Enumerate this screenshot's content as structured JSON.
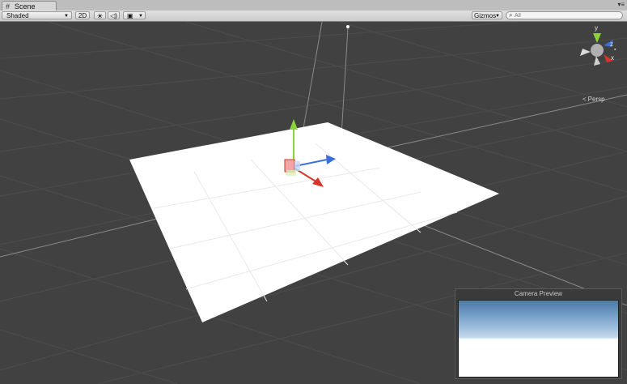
{
  "tab": {
    "icon": "scene-grid-icon",
    "label": "Scene",
    "menu_icon": "panel-menu-icon"
  },
  "toolbar": {
    "draw_mode": "Shaded",
    "btn_2d": "2D",
    "lighting_icon": "sun-icon",
    "audio_icon": "speaker-icon",
    "effects_icon": "image-icon",
    "gizmos": "Gizmos",
    "search_placeholder": "All",
    "search_icon": "search-icon"
  },
  "orientation_gizmo": {
    "y_label": "y",
    "x_label": "x",
    "z_label": "z",
    "projection": "Persp",
    "lock_icon": "lock-icon",
    "axis_colors": {
      "x": "#d8342a",
      "y": "#8cd23a",
      "z": "#3a6fd8"
    }
  },
  "camera_preview": {
    "title": "Camera Preview"
  },
  "colors": {
    "viewport_bg": "#414141",
    "plane": "#ffffff",
    "grid": "#4a4a4a"
  }
}
